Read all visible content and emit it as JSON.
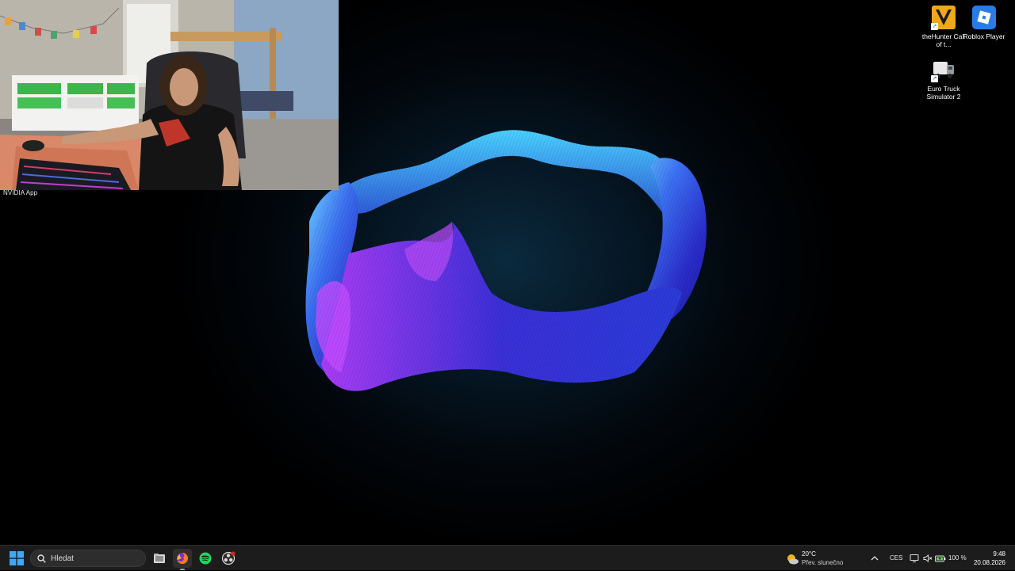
{
  "webcam": {
    "source_label": "NVIDIA App"
  },
  "desktop_icons": [
    {
      "label": "theHunter Call of t...",
      "icon": "thehunter-icon"
    },
    {
      "label": "Roblox Player",
      "icon": "roblox-icon"
    },
    {
      "label": "Euro Truck Simulator 2",
      "icon": "euro-truck-icon"
    }
  ],
  "taskbar": {
    "search_placeholder": "Hledat",
    "apps": [
      {
        "name": "file-explorer",
        "icon": "folder-icon"
      },
      {
        "name": "firefox",
        "icon": "firefox-icon",
        "active": true
      },
      {
        "name": "spotify",
        "icon": "spotify-icon"
      },
      {
        "name": "obs",
        "icon": "obs-icon",
        "badge": true
      }
    ],
    "weather": {
      "temp": "20°C",
      "condition": "Přev. slunečno"
    },
    "language": "CES",
    "battery": "100 %",
    "time": "9:48",
    "date": "20.08.2026"
  },
  "colors": {
    "taskbar_bg": "#1c1c1c",
    "wallpaper_blue": "#2e37d8",
    "wallpaper_cyan": "#39c6ff",
    "wallpaper_magenta": "#b23bff",
    "windows_blue": "#3fa7f5",
    "spotify_green": "#1ed760",
    "roblox_blue": "#2a7be4"
  }
}
